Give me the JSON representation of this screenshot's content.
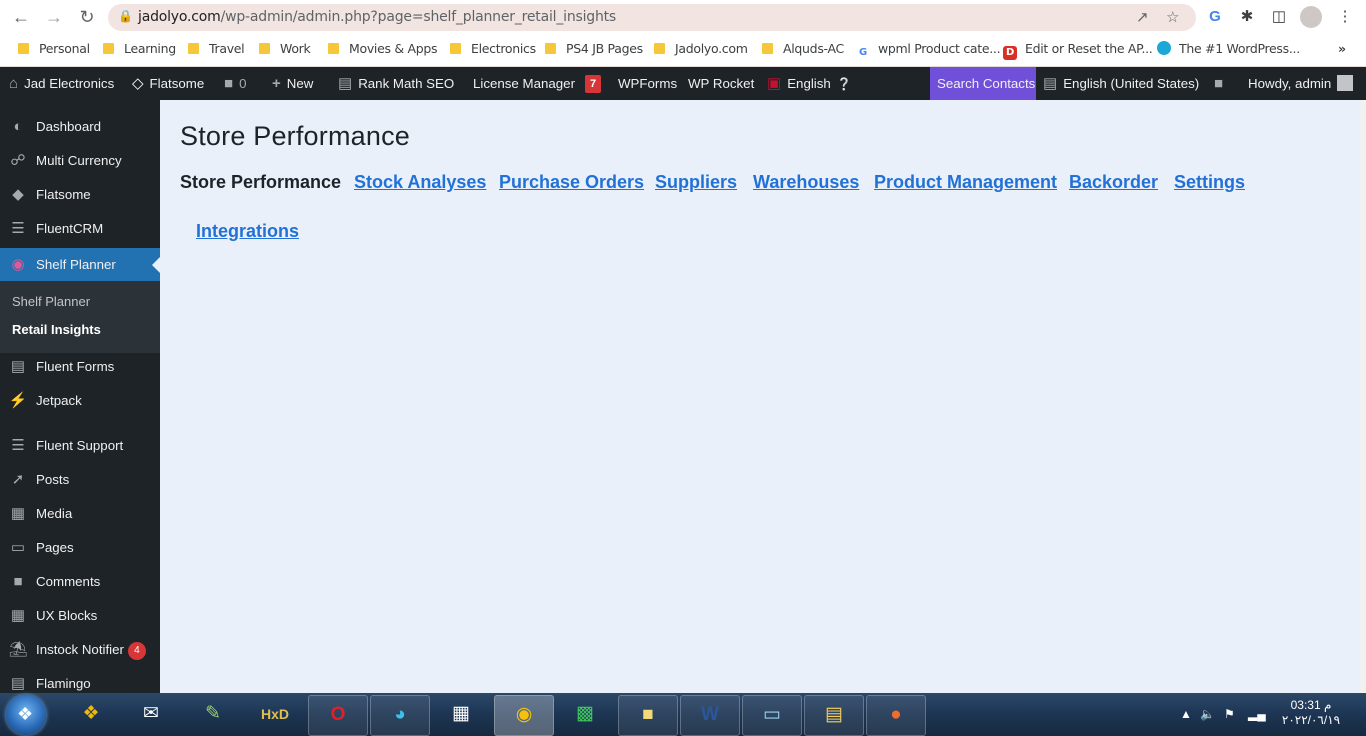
{
  "browser": {
    "url_domain": "jadolyo.com",
    "url_path": "/wp-admin/admin.php?page=shelf_planner_retail_insights",
    "bookmarks": [
      {
        "label": "Personal",
        "kind": "folder"
      },
      {
        "label": "Learning",
        "kind": "folder"
      },
      {
        "label": "Travel",
        "kind": "folder"
      },
      {
        "label": "Work",
        "kind": "folder"
      },
      {
        "label": "Movies & Apps",
        "kind": "folder"
      },
      {
        "label": "Electronics",
        "kind": "folder"
      },
      {
        "label": "PS4 JB Pages",
        "kind": "folder"
      },
      {
        "label": "Jadolyo.com",
        "kind": "folder"
      },
      {
        "label": "Alquds-AC",
        "kind": "folder"
      },
      {
        "label": "wpml Product cate...",
        "kind": "google"
      },
      {
        "label": "Edit or Reset the AP...",
        "kind": "site"
      },
      {
        "label": "The #1 WordPress...",
        "kind": "site2"
      }
    ]
  },
  "adminbar": {
    "site_name": "Jad Electronics",
    "flatsome": "Flatsome",
    "comments_count": "0",
    "new": "New",
    "rank_math": "Rank Math SEO",
    "license_manager": "License Manager",
    "badge": "7",
    "wpforms": "WPForms",
    "wp_rocket": "WP Rocket",
    "language": "English",
    "search_contacts": "Search Contacts",
    "locale": "English (United States)",
    "howdy": "Howdy, admin"
  },
  "sidebar": {
    "items": [
      {
        "label": "Dashboard",
        "icon": "dashboard-icon"
      },
      {
        "label": "Multi Currency",
        "icon": "currency-icon"
      },
      {
        "label": "Flatsome",
        "icon": "flatsome-icon"
      },
      {
        "label": "FluentCRM",
        "icon": "fluentcrm-icon"
      },
      {
        "label": "Shelf Planner",
        "icon": "shelf-planner-icon"
      },
      {
        "label": "Fluent Forms",
        "icon": "forms-icon"
      },
      {
        "label": "Jetpack",
        "icon": "jetpack-icon"
      },
      {
        "label": "Fluent Support",
        "icon": "support-icon"
      },
      {
        "label": "Posts",
        "icon": "pin-icon"
      },
      {
        "label": "Media",
        "icon": "media-icon"
      },
      {
        "label": "Pages",
        "icon": "pages-icon"
      },
      {
        "label": "Comments",
        "icon": "comment-icon"
      },
      {
        "label": "UX Blocks",
        "icon": "blocks-icon"
      },
      {
        "label": "Instock Notifier",
        "icon": "notifier-icon",
        "count": "4"
      },
      {
        "label": "Flamingo",
        "icon": "flamingo-icon"
      }
    ],
    "submenu": [
      {
        "label": "Shelf Planner"
      },
      {
        "label": "Retail Insights"
      }
    ]
  },
  "main": {
    "title": "Store Performance",
    "tabs": [
      {
        "label": "Store Performance"
      },
      {
        "label": "Stock Analyses"
      },
      {
        "label": "Purchase Orders"
      },
      {
        "label": "Suppliers"
      },
      {
        "label": "Warehouses"
      },
      {
        "label": "Product Management"
      },
      {
        "label": "Backorder"
      },
      {
        "label": "Settings"
      },
      {
        "label": "Integrations"
      }
    ]
  },
  "taskbar": {
    "time": "03:31 م",
    "date": "٢٠٢٢/٠٦/١٩"
  },
  "colors": {
    "adminbar_bg": "#1d2327",
    "active_menu": "#2271b1",
    "search_contacts_bg": "#7050d8",
    "link": "#2271d6",
    "content_bg": "#eaf0f9"
  }
}
